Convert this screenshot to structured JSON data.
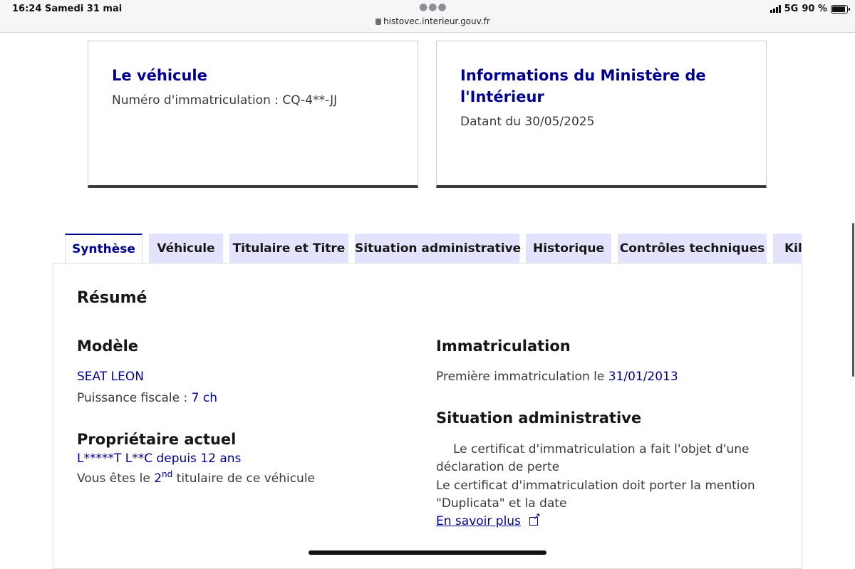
{
  "status_bar": {
    "time": "16:24",
    "date": "Samedi 31 mai",
    "url": "histovec.interieur.gouv.fr",
    "network": "5G",
    "battery": "90 %",
    "battery_level": 0.9
  },
  "cards": {
    "vehicle": {
      "title": "Le véhicule",
      "text": "Numéro d'immatriculation : CQ-4**-JJ"
    },
    "ministry": {
      "title": "Informations du Ministère de l'Intérieur",
      "text": "Datant du 30/05/2025"
    }
  },
  "tabs": [
    {
      "label": "Synthèse",
      "active": true
    },
    {
      "label": "Véhicule",
      "active": false
    },
    {
      "label": "Titulaire et Titre",
      "active": false
    },
    {
      "label": "Situation administrative",
      "active": false
    },
    {
      "label": "Historique",
      "active": false
    },
    {
      "label": "Contrôles techniques",
      "active": false
    },
    {
      "label": "Kil",
      "active": false
    }
  ],
  "summary": {
    "title": "Résumé",
    "model": {
      "heading": "Modèle",
      "name": "SEAT LEON",
      "power_label": "Puissance fiscale : ",
      "power_value": "7 ch"
    },
    "owner": {
      "heading": "Propriétaire actuel",
      "name": "L*****T L**C",
      "since_label": " depuis ",
      "since_value": "12 ans",
      "rank_prefix": "Vous êtes le ",
      "rank_number": "2",
      "rank_suffix_sup": "nd",
      "rank_suffix": " titulaire de ce véhicule"
    },
    "registration": {
      "heading": "Immatriculation",
      "label": "Première immatriculation le ",
      "date": "31/01/2013"
    },
    "admin": {
      "heading": "Situation administrative",
      "line1": "Le certificat d'immatriculation a fait l'objet d'une",
      "line2": "déclaration de perte",
      "line3": "Le certificat d'immatriculation doit porter la mention",
      "line4": "\"Duplicata\" et la date",
      "link": "En savoir plus"
    }
  }
}
